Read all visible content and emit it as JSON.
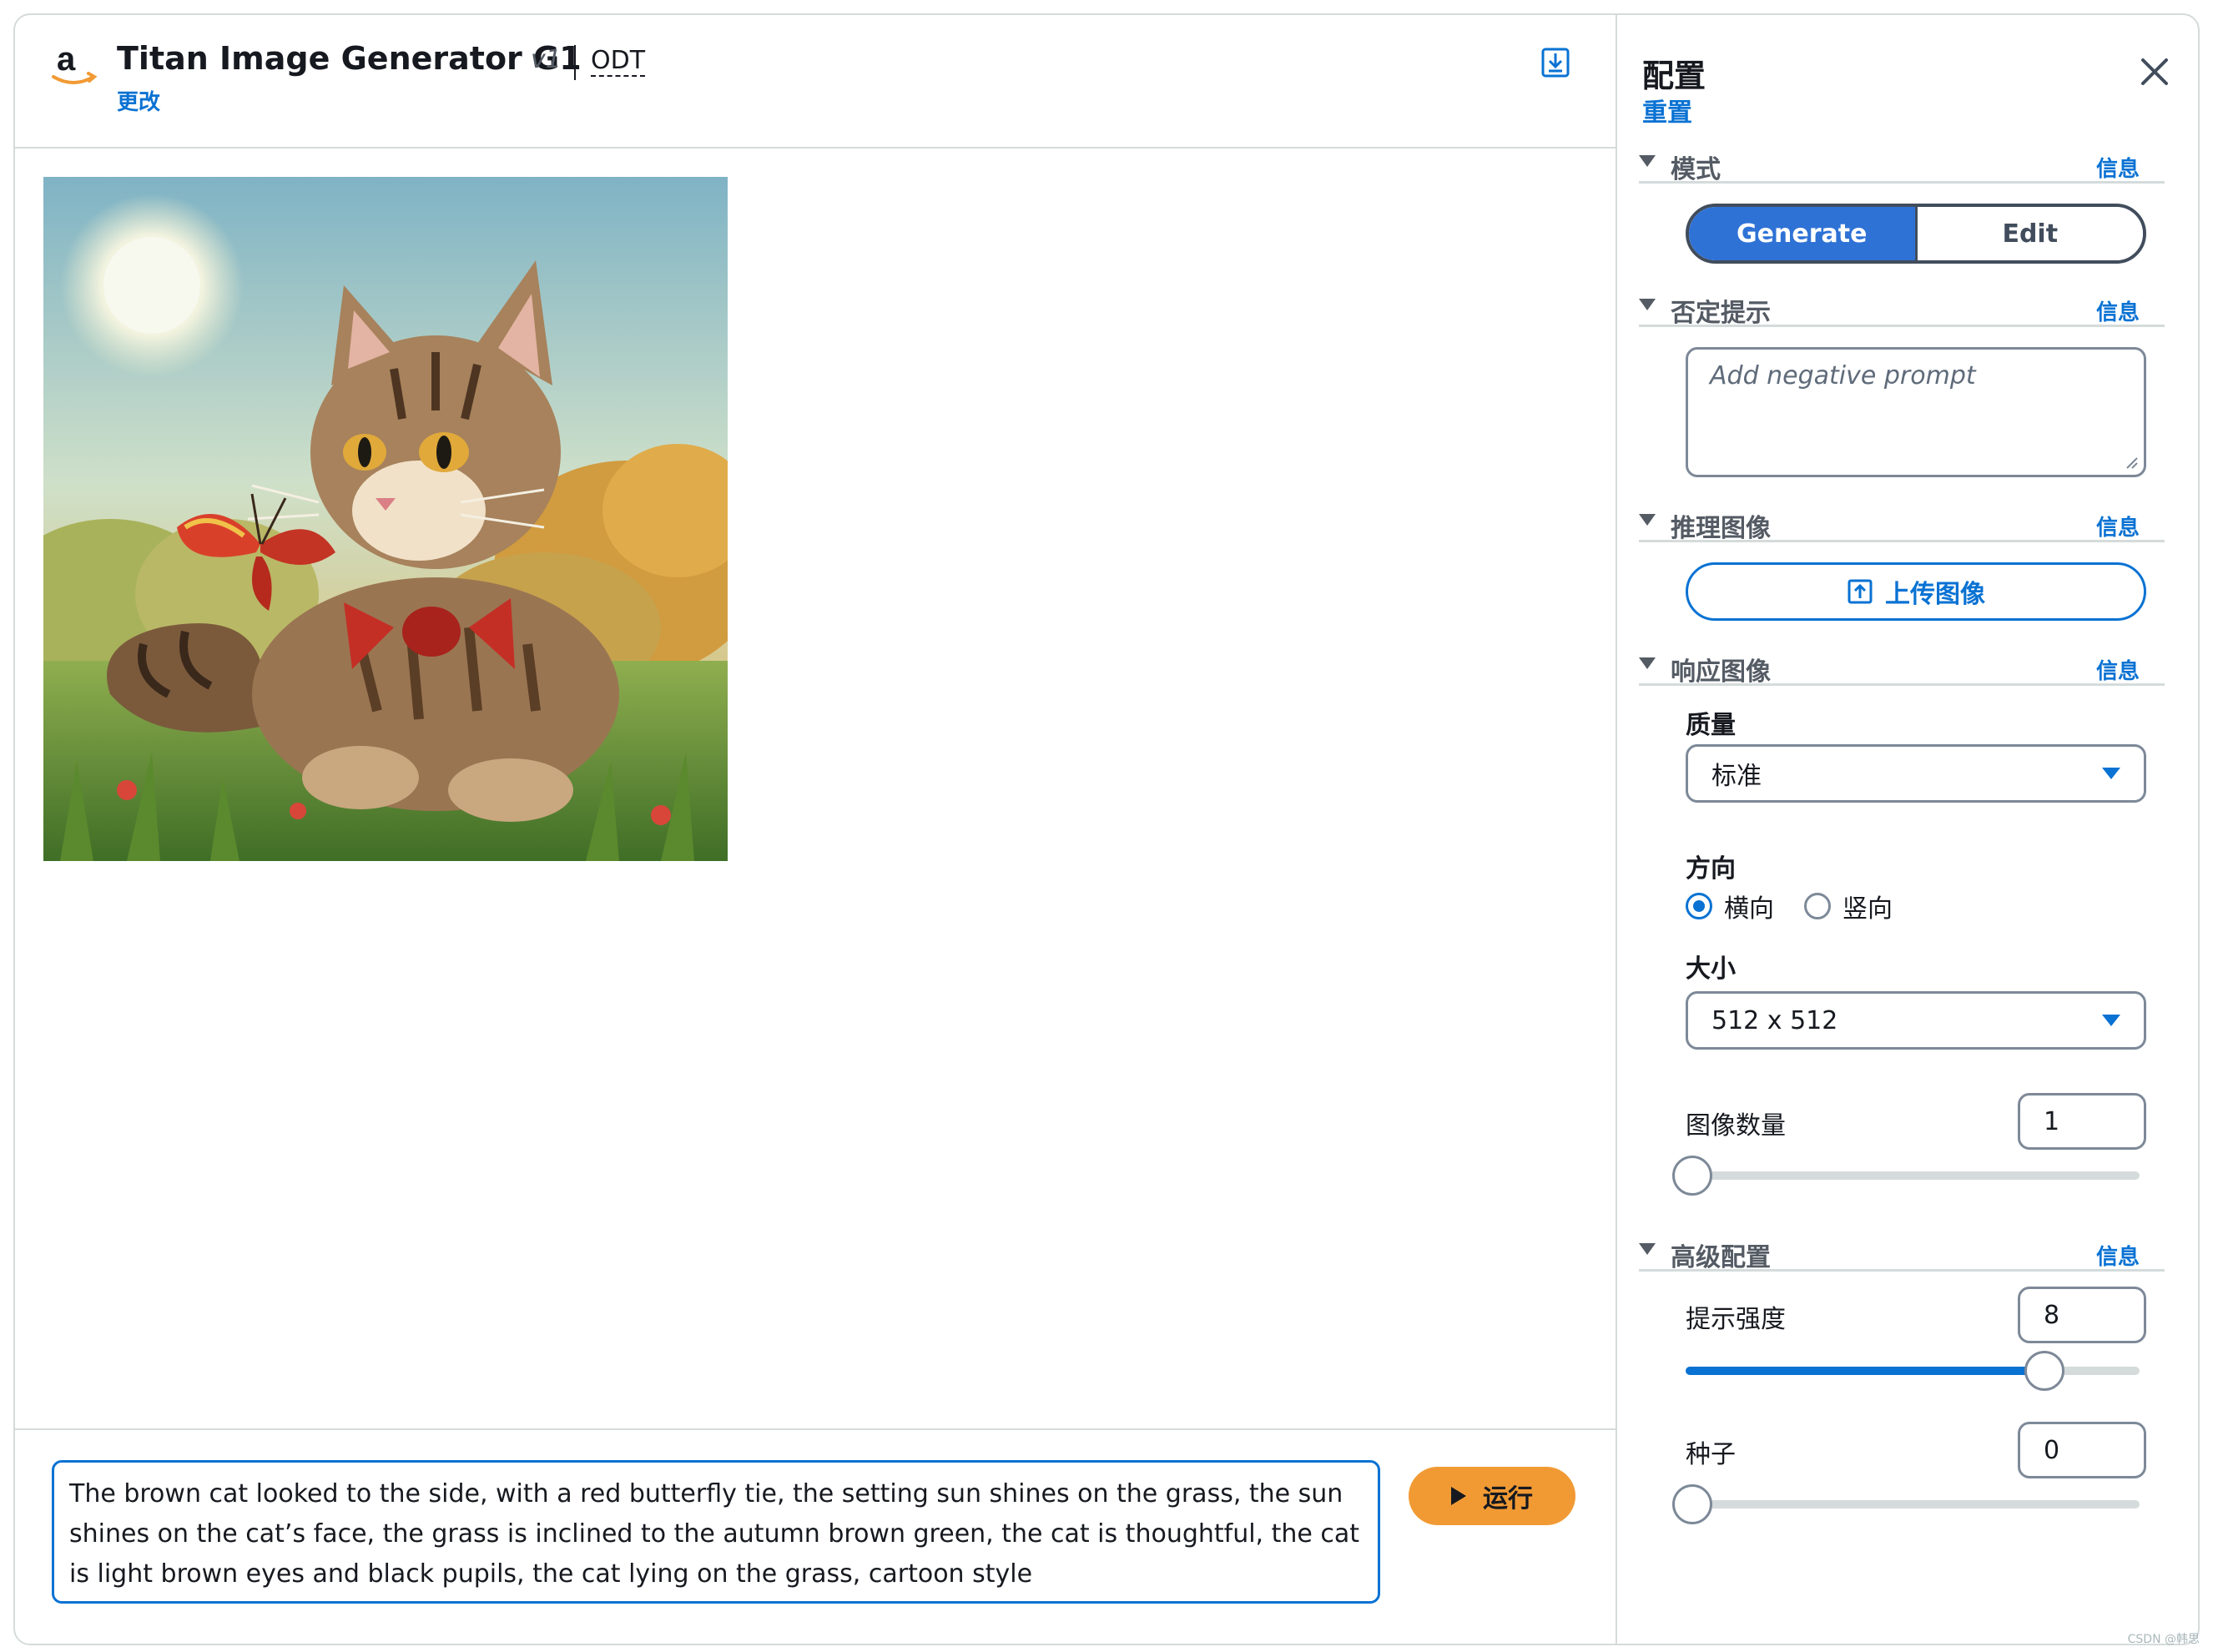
{
  "header": {
    "title": "Titan Image Generator G1",
    "version": "v1",
    "odt": "ODT",
    "change_link": "更改"
  },
  "prompt": {
    "text": "The brown cat looked to the side, with a red butterfly tie, the setting sun shines on the grass, the sun shines on the cat’s face, the grass is inclined to the autumn brown green, the cat is thoughtful, the cat is light brown eyes and black pupils, the cat lying on the grass, cartoon style"
  },
  "run_button": {
    "label": "运行",
    "color": "#f19a34"
  },
  "config": {
    "title": "配置",
    "reset": "重置",
    "info": "信息",
    "mode": {
      "label": "模式",
      "options": [
        "Generate",
        "Edit"
      ],
      "selected": "Generate"
    },
    "negative_prompt": {
      "label": "否定提示",
      "placeholder": "Add negative prompt"
    },
    "inference_image": {
      "label": "推理图像",
      "upload_label": "上传图像"
    },
    "response_image": {
      "label": "响应图像",
      "quality_label": "质量",
      "quality_value": "标准",
      "orientation_label": "方向",
      "orientation_options": [
        "横向",
        "竖向"
      ],
      "orientation_selected": "横向",
      "size_label": "大小",
      "size_value": "512 x 512",
      "count_label": "图像数量",
      "count_value": "1",
      "count_slider_fraction": 0.0
    },
    "advanced": {
      "label": "高级配置",
      "prompt_strength_label": "提示强度",
      "prompt_strength_value": "8",
      "prompt_strength_fraction": 0.79,
      "seed_label": "种子",
      "seed_value": "0",
      "seed_slider_fraction": 0.0
    }
  },
  "colors": {
    "accent": "#0972d3",
    "segment_active": "#2f72d6",
    "run": "#f19a34",
    "border": "#d5dbdb"
  },
  "icons": [
    "amazon-logo",
    "download-icon",
    "close-icon",
    "upload-icon",
    "play-icon",
    "caret-down-icon"
  ],
  "watermark": "CSDN @韩思"
}
